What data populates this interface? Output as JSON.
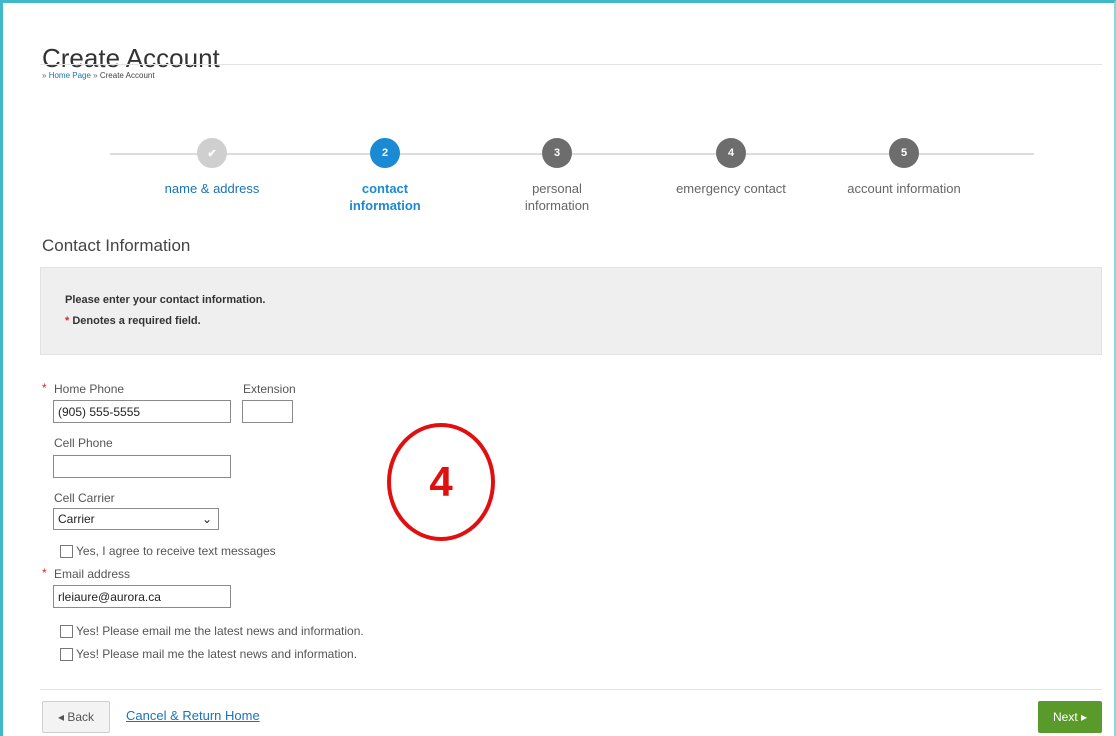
{
  "page": {
    "title": "Create Account"
  },
  "breadcrumb": {
    "prefix": "»",
    "home": "Home Page",
    "separator": "»",
    "current": "Create Account"
  },
  "steps": [
    {
      "label": "name & address",
      "badge": "✔",
      "state": "done"
    },
    {
      "label": "contact information",
      "badge": "2",
      "state": "active"
    },
    {
      "label": "personal information",
      "badge": "3",
      "state": "todo"
    },
    {
      "label": "emergency contact",
      "badge": "4",
      "state": "todo"
    },
    {
      "label": "account information",
      "badge": "5",
      "state": "todo"
    }
  ],
  "section": {
    "heading": "Contact Information",
    "instructions": "Please enter your contact information.",
    "required_star": "*",
    "required_note": "Denotes a required field."
  },
  "form": {
    "required_star": "*",
    "home_phone_label": "Home Phone",
    "home_phone_value": "(905) 555-5555",
    "extension_label": "Extension",
    "extension_value": "",
    "cell_phone_label": "Cell Phone",
    "cell_phone_value": "",
    "cell_carrier_label": "Cell Carrier",
    "cell_carrier_selected": "Carrier",
    "text_opt_in_label": "Yes, I agree to receive text messages",
    "email_label": "Email address",
    "email_value": "rleiaure@aurora.ca",
    "email_news_label": "Yes! Please email me the latest news and information.",
    "mail_news_label": "Yes! Please mail me the latest news and information."
  },
  "annotation": {
    "number": "4",
    "color": "#e01010"
  },
  "footer": {
    "back_label": "◂ Back",
    "cancel_label": "Cancel & Return Home",
    "next_label": "Next ▸"
  },
  "colors": {
    "accent": "#1a8ad4",
    "link": "#1a73b8",
    "next_button": "#5a9a2a",
    "required": "#d62a2a"
  }
}
